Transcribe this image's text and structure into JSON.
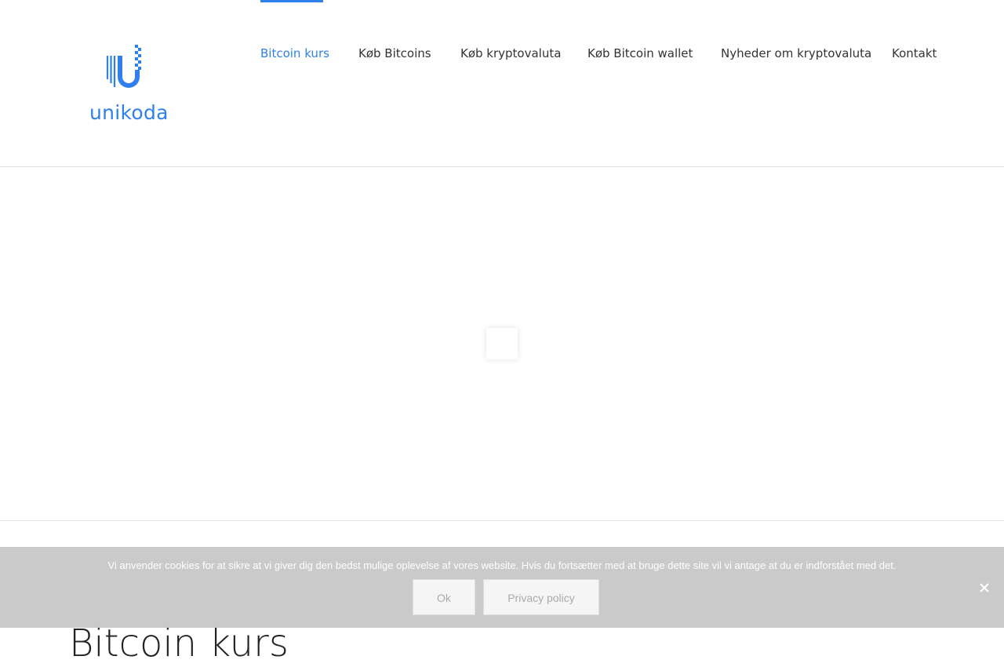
{
  "header": {
    "logo_text": "unikoda",
    "nav": [
      {
        "label": "Bitcoin kurs",
        "active": true
      },
      {
        "label": "Køb Bitcoins",
        "active": false
      },
      {
        "label": "Køb kryptovaluta",
        "active": false
      },
      {
        "label": "Køb Bitcoin wallet",
        "active": false
      },
      {
        "label": "Nyheder om kryptovaluta",
        "active": false
      },
      {
        "label": "Kontakt",
        "active": false
      }
    ]
  },
  "main": {
    "loader_icon": "spinner-icon",
    "page_title": "Bitcoin kurs"
  },
  "cookie_notice": {
    "text": "Vi anvender cookies for at sikre at vi giver dig den bedst mulige oplevelse af vores website. Hvis du fortsætter med at bruge dette site vil vi antage at du er indforstået med det.",
    "ok_label": "Ok",
    "policy_label": "Privacy policy",
    "close_icon": "close-icon"
  },
  "colors": {
    "accent": "#2f80ed",
    "text": "#333333",
    "cookie_bg": "#c8c8c8"
  }
}
